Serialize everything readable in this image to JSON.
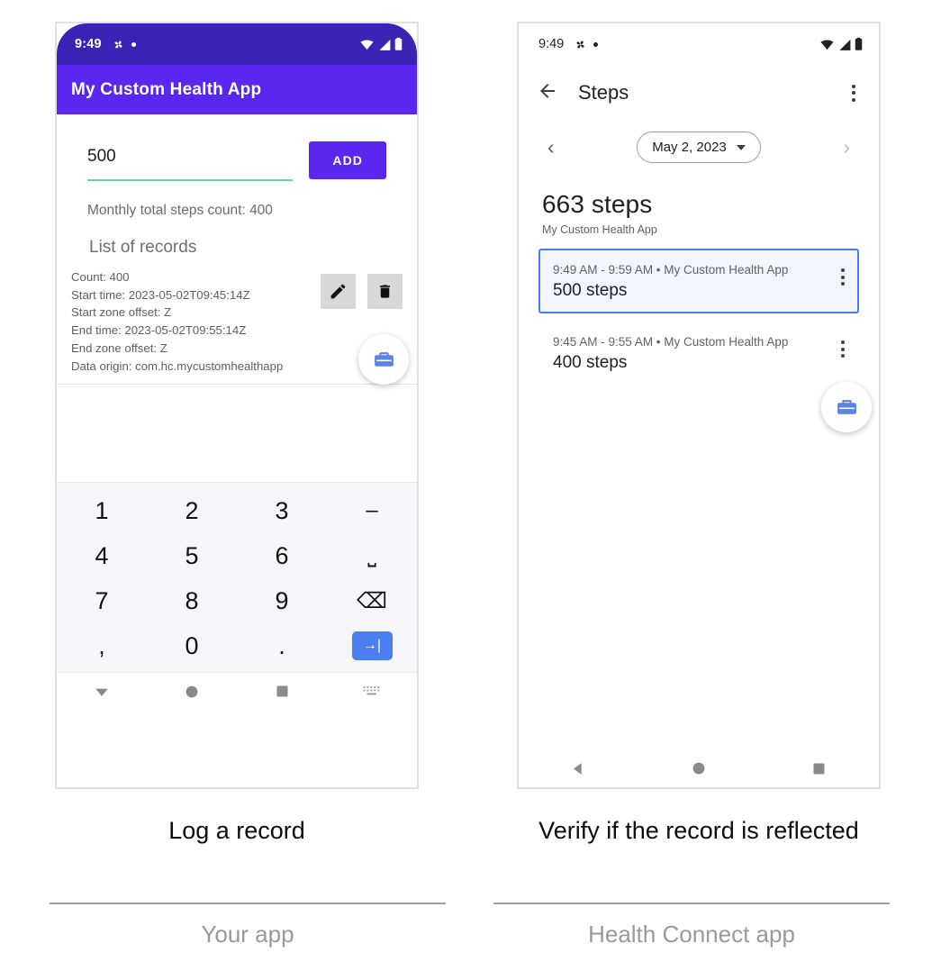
{
  "left_phone": {
    "status_bar": {
      "clock": "9:49",
      "icons": [
        "pinwheel-icon",
        "dot-icon",
        "wifi-icon",
        "signal-icon",
        "battery-icon"
      ]
    },
    "app_bar": {
      "title": "My Custom Health App",
      "color": "#5927f0"
    },
    "input": {
      "value": "500",
      "underline_color": "#5fd3bb"
    },
    "add_button": {
      "label": "ADD",
      "color": "#5927f0"
    },
    "monthly_total": "Monthly total steps count: 400",
    "list_header": "List of records",
    "record": {
      "count": "Count: 400",
      "start_time": "Start time: 2023-05-02T09:45:14Z",
      "start_zone_offset": "Start zone offset: Z",
      "end_time": "End time: 2023-05-02T09:55:14Z",
      "end_zone_offset": "End zone offset: Z",
      "data_origin": "Data origin: com.hc.mycustomhealthapp"
    },
    "keypad": {
      "rows": [
        [
          "1",
          "2",
          "3",
          "–"
        ],
        [
          "4",
          "5",
          "6",
          "⎵"
        ],
        [
          "7",
          "8",
          "9",
          "⌫"
        ],
        [
          ",",
          "0",
          ".",
          "→|"
        ]
      ]
    },
    "nav_bar": [
      "hide-keyboard-icon",
      "home-icon",
      "recents-icon",
      "keyboard-switch-icon"
    ]
  },
  "right_phone": {
    "status_bar": {
      "clock": "9:49",
      "icons": [
        "pinwheel-icon",
        "dot-icon",
        "wifi-icon",
        "signal-icon",
        "battery-icon"
      ]
    },
    "app_bar": {
      "title": "Steps",
      "back_icon": "←"
    },
    "date_nav": {
      "prev": "‹",
      "next": "›",
      "date": "May 2, 2023"
    },
    "total": {
      "value": "663 steps",
      "source": "My Custom Health App"
    },
    "records": [
      {
        "meta": "9:49 AM - 9:59 AM • My Custom Health App",
        "value": "500 steps",
        "selected": true
      },
      {
        "meta": "9:45 AM - 9:55 AM • My Custom Health App",
        "value": "400 steps",
        "selected": false
      }
    ],
    "selection_color": "#4a7cf0",
    "nav_bar": [
      "back-icon",
      "home-icon",
      "recents-icon"
    ]
  },
  "captions": {
    "left_step": "Log a record",
    "right_step": "Verify if the record is reflected",
    "left_app": "Your app",
    "right_app": "Health Connect app"
  }
}
